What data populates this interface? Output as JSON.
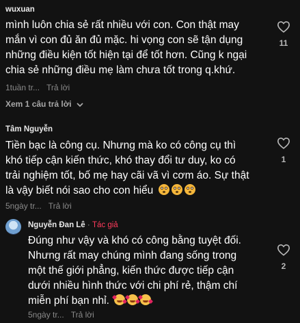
{
  "comments": [
    {
      "username": "wuxuan",
      "lines": [
        "mình luôn chia sẻ rất nhiều với con. Con thật may",
        "mắn vì con đủ ăn đủ mặc. hi vọng con sẽ tận dụng",
        "những điều kiện tốt hiện tại để tốt hơn. Cũng k ngại",
        "chia sẻ những điều mẹ làm chưa tốt trong q.khứ."
      ],
      "time": "1tuần tr...",
      "reply_label": "Trả lời",
      "likes": "11"
    },
    {
      "username": "Tâm Nguyễn",
      "lines": [
        "Tiền bạc là công cụ. Nhưng mà ko có công cụ thì",
        "khó tiếp cận kiến thức, khó thay đổi tư duy, ko có",
        "trải nghiệm tốt, bố mẹ hay cãi vã vì cơm áo. Sự thật",
        "là vậy biết nói sao cho con hiểu"
      ],
      "emoji": [
        "flushed-face",
        "flushed-face",
        "flushed-face"
      ],
      "time": "5ngày tr...",
      "reply_label": "Trả lời",
      "likes": "1"
    },
    {
      "username": "Nguyễn Đan Lê",
      "separator": "·",
      "badge": "Tác giả",
      "lines": [
        "Đúng như vậy và khó có công bằng tuyệt đối.",
        "Nhưng rất may chúng mình đang sống trong",
        "một thế giới phẳng, kiến thức được tiếp cận",
        "dưới nhiều hình thức với chi phí rẻ, thậm chí",
        "miễn phí bạn nhỉ."
      ],
      "emoji": [
        "smiling-face-with-hearts",
        "smiling-face-with-hearts",
        "smiling-face-with-hearts"
      ],
      "time": "5ngày tr...",
      "reply_label": "Trả lời",
      "likes": "2"
    }
  ],
  "view_replies_label": "Xem 1 câu trả lời",
  "icons": {
    "like": "heart-outline-icon",
    "expand": "chevron-down-icon"
  },
  "colors": {
    "background": "#121212",
    "author_badge": "#ff3b5c",
    "meta": "#8a8a8a"
  }
}
